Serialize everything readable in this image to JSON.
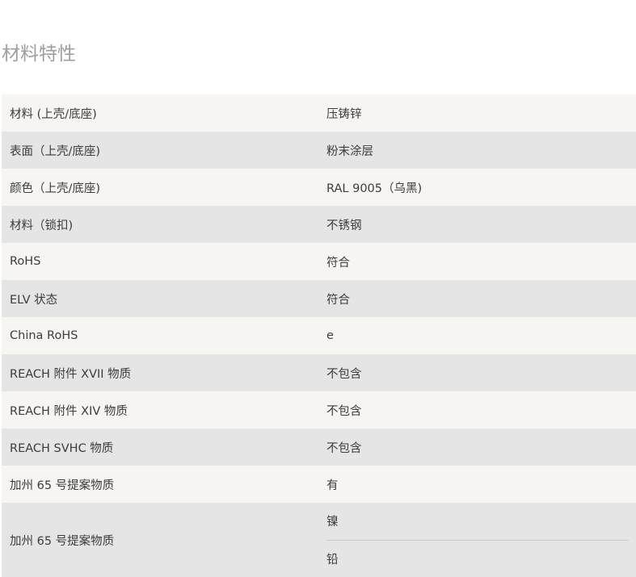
{
  "section": {
    "title": "材料特性"
  },
  "rows": [
    {
      "key": "材料 (上壳/底座)",
      "value": "压铸锌"
    },
    {
      "key": "表面（上壳/底座)",
      "value": "粉末涂层"
    },
    {
      "key": "颜色（上壳/底座)",
      "value": "RAL 9005（乌黑)"
    },
    {
      "key": "材料（锁扣)",
      "value": "不锈钢"
    },
    {
      "key": "RoHS",
      "value": "符合"
    },
    {
      "key": "ELV 状态",
      "value": "符合"
    },
    {
      "key": "China RoHS",
      "value": "e"
    },
    {
      "key": "REACH 附件 XVII 物质",
      "value": "不包含"
    },
    {
      "key": "REACH 附件 XIV 物质",
      "value": "不包含"
    },
    {
      "key": "REACH SVHC 物质",
      "value": "不包含"
    },
    {
      "key": "加州 65 号提案物质",
      "value": "有"
    },
    {
      "key": "加州 65 号提案物质",
      "values": [
        "镍",
        "铅"
      ]
    }
  ],
  "colors": {
    "row_light": "#f6f5f2",
    "row_dark": "#e5e5e5",
    "title_text": "#a09e9b",
    "body_text": "#3c3c3c",
    "divider": "#c8c8c8"
  }
}
